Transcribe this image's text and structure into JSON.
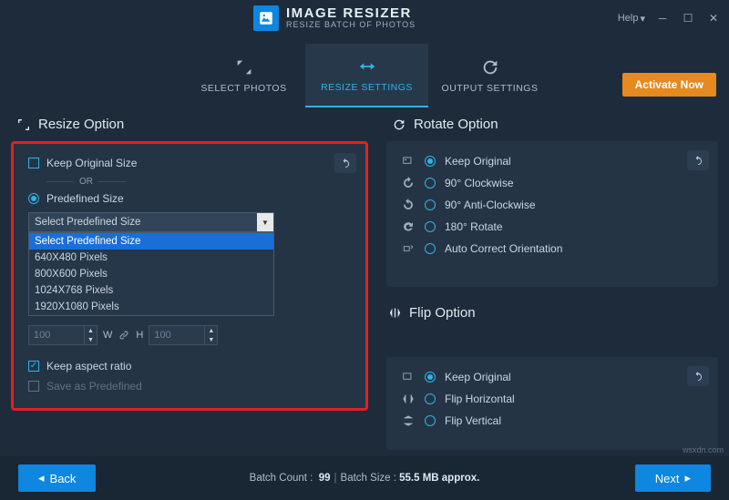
{
  "app": {
    "title": "IMAGE RESIZER",
    "subtitle": "RESIZE BATCH OF PHOTOS",
    "help": "Help"
  },
  "tabs": {
    "select_photos": "SELECT PHOTOS",
    "resize_settings": "RESIZE SETTINGS",
    "output_settings": "OUTPUT SETTINGS",
    "activate": "Activate Now"
  },
  "resize": {
    "title": "Resize Option",
    "keep_original": "Keep Original Size",
    "or": "OR",
    "predefined": "Predefined Size",
    "select_placeholder": "Select Predefined Size",
    "options": [
      "Select Predefined Size",
      "640X480 Pixels",
      "800X600 Pixels",
      "1024X768 Pixels",
      "1920X1080 Pixels"
    ],
    "w_label": "W",
    "h_label": "H",
    "w_value": "100",
    "h_value": "100",
    "aspect": "Keep aspect ratio",
    "save_predef": "Save as Predefined"
  },
  "rotate": {
    "title": "Rotate Option",
    "keep": "Keep Original",
    "cw90": "90° Clockwise",
    "acw90": "90° Anti-Clockwise",
    "r180": "180° Rotate",
    "auto": "Auto Correct Orientation"
  },
  "flip": {
    "title": "Flip Option",
    "keep": "Keep Original",
    "horiz": "Flip Horizontal",
    "vert": "Flip Vertical"
  },
  "footer": {
    "back": "Back",
    "next": "Next",
    "count_label": "Batch Count :",
    "count_value": "99",
    "size_label": "Batch Size :",
    "size_value": "55.5 MB approx."
  },
  "watermark": "wsxdn.com"
}
